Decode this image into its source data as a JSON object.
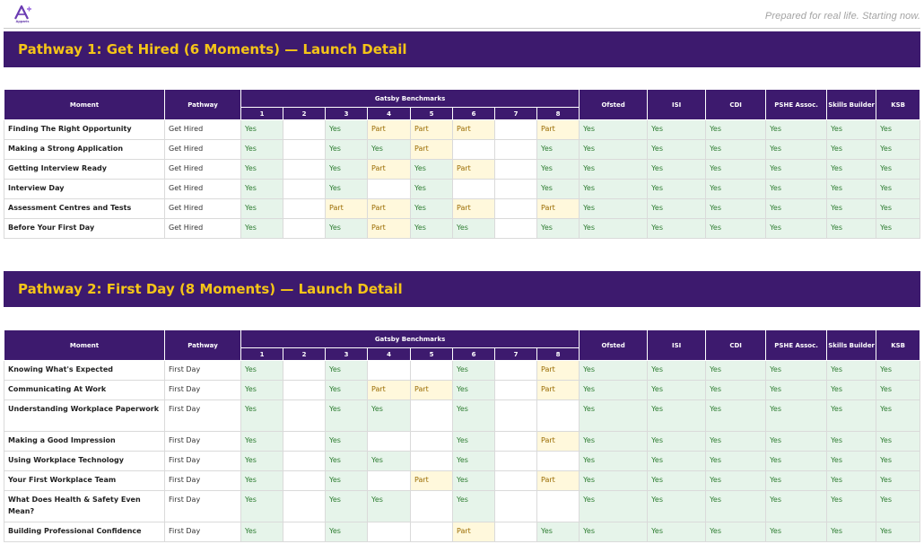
{
  "brand": {
    "logo_word": "Apparis",
    "tagline": "Prepared for real life. Starting now."
  },
  "headers": {
    "moment": "Moment",
    "pathway": "Pathway",
    "gatsby": "Gatsby Benchmarks",
    "gatsby_numbers": [
      "1",
      "2",
      "3",
      "4",
      "5",
      "6",
      "7",
      "8"
    ],
    "frameworks": [
      "Ofsted",
      "ISI",
      "CDI",
      "PSHE Assoc.",
      "Skills Builder",
      "KSB"
    ]
  },
  "pathway1": {
    "title": "Pathway 1: Get Hired (6 Moments) — Launch Detail",
    "rows": [
      {
        "moment": "Finding The Right Opportunity",
        "pathway": "Get Hired",
        "gatsby": [
          "Yes",
          "",
          "Yes",
          "Part",
          "Part",
          "Part",
          "",
          "Part"
        ],
        "frameworks": [
          "Yes",
          "Yes",
          "Yes",
          "Yes",
          "Yes",
          "Yes"
        ]
      },
      {
        "moment": "Making a Strong Application",
        "pathway": "Get Hired",
        "gatsby": [
          "Yes",
          "",
          "Yes",
          "Yes",
          "Part",
          "",
          "",
          "Yes"
        ],
        "frameworks": [
          "Yes",
          "Yes",
          "Yes",
          "Yes",
          "Yes",
          "Yes"
        ]
      },
      {
        "moment": "Getting Interview Ready",
        "pathway": "Get Hired",
        "gatsby": [
          "Yes",
          "",
          "Yes",
          "Part",
          "Yes",
          "Part",
          "",
          "Yes"
        ],
        "frameworks": [
          "Yes",
          "Yes",
          "Yes",
          "Yes",
          "Yes",
          "Yes"
        ]
      },
      {
        "moment": "Interview Day",
        "pathway": "Get Hired",
        "gatsby": [
          "Yes",
          "",
          "Yes",
          "",
          "Yes",
          "",
          "",
          "Yes"
        ],
        "frameworks": [
          "Yes",
          "Yes",
          "Yes",
          "Yes",
          "Yes",
          "Yes"
        ]
      },
      {
        "moment": "Assessment Centres and Tests",
        "pathway": "Get Hired",
        "gatsby": [
          "Yes",
          "",
          "Part",
          "Part",
          "Yes",
          "Part",
          "",
          "Part"
        ],
        "frameworks": [
          "Yes",
          "Yes",
          "Yes",
          "Yes",
          "Yes",
          "Yes"
        ]
      },
      {
        "moment": "Before Your First Day",
        "pathway": "Get Hired",
        "gatsby": [
          "Yes",
          "",
          "Yes",
          "Part",
          "Yes",
          "Yes",
          "",
          "Yes"
        ],
        "frameworks": [
          "Yes",
          "Yes",
          "Yes",
          "Yes",
          "Yes",
          "Yes"
        ]
      }
    ]
  },
  "pathway2": {
    "title": "Pathway 2: First Day (8 Moments) — Launch Detail",
    "rows": [
      {
        "moment": "Knowing What's Expected",
        "pathway": "First Day",
        "gatsby": [
          "Yes",
          "",
          "Yes",
          "",
          "",
          "Yes",
          "",
          "Part"
        ],
        "frameworks": [
          "Yes",
          "Yes",
          "Yes",
          "Yes",
          "Yes",
          "Yes"
        ]
      },
      {
        "moment": "Communicating At Work",
        "pathway": "First Day",
        "gatsby": [
          "Yes",
          "",
          "Yes",
          "Part",
          "Part",
          "Yes",
          "",
          "Part"
        ],
        "frameworks": [
          "Yes",
          "Yes",
          "Yes",
          "Yes",
          "Yes",
          "Yes"
        ]
      },
      {
        "moment": "Understanding Workplace Paperwork",
        "pathway": "First Day",
        "gatsby": [
          "Yes",
          "",
          "Yes",
          "Yes",
          "",
          "Yes",
          "",
          ""
        ],
        "frameworks": [
          "Yes",
          "Yes",
          "Yes",
          "Yes",
          "Yes",
          "Yes"
        ]
      },
      {
        "moment": "Making a Good Impression",
        "pathway": "First Day",
        "gatsby": [
          "Yes",
          "",
          "Yes",
          "",
          "",
          "Yes",
          "",
          "Part"
        ],
        "frameworks": [
          "Yes",
          "Yes",
          "Yes",
          "Yes",
          "Yes",
          "Yes"
        ]
      },
      {
        "moment": "Using Workplace Technology",
        "pathway": "First Day",
        "gatsby": [
          "Yes",
          "",
          "Yes",
          "Yes",
          "",
          "Yes",
          "",
          ""
        ],
        "frameworks": [
          "Yes",
          "Yes",
          "Yes",
          "Yes",
          "Yes",
          "Yes"
        ]
      },
      {
        "moment": "Your First Workplace Team",
        "pathway": "First Day",
        "gatsby": [
          "Yes",
          "",
          "Yes",
          "",
          "Part",
          "Yes",
          "",
          "Part"
        ],
        "frameworks": [
          "Yes",
          "Yes",
          "Yes",
          "Yes",
          "Yes",
          "Yes"
        ]
      },
      {
        "moment": "What Does Health & Safety Even Mean?",
        "pathway": "First Day",
        "gatsby": [
          "Yes",
          "",
          "Yes",
          "Yes",
          "",
          "Yes",
          "",
          ""
        ],
        "frameworks": [
          "Yes",
          "Yes",
          "Yes",
          "Yes",
          "Yes",
          "Yes"
        ]
      },
      {
        "moment": "Building Professional Confidence",
        "pathway": "First Day",
        "gatsby": [
          "Yes",
          "",
          "Yes",
          "",
          "",
          "Part",
          "",
          "Yes"
        ],
        "frameworks": [
          "Yes",
          "Yes",
          "Yes",
          "Yes",
          "Yes",
          "Yes"
        ]
      }
    ]
  },
  "colors": {
    "header_purple": "#3d1a6e",
    "title_yellow": "#f5c518",
    "yes_bg": "#e6f4ea",
    "yes_text": "#2e7d32",
    "part_bg": "#fff8dc",
    "part_text": "#9a6b00"
  }
}
